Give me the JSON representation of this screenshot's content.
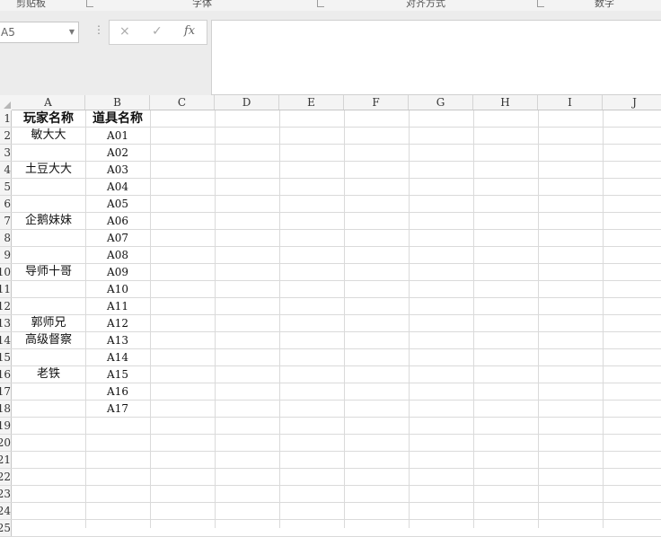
{
  "ribbon": {
    "groups": [
      {
        "label": "剪贴板"
      },
      {
        "label": "字体"
      },
      {
        "label": "对齐方式"
      },
      {
        "label": "数字"
      }
    ]
  },
  "formula_bar": {
    "name_box": "A5",
    "cancel_icon": "×",
    "enter_icon": "✓",
    "fx_label": "fx",
    "formula_value": ""
  },
  "sheet": {
    "columns": [
      "A",
      "B",
      "C",
      "D",
      "E",
      "F",
      "G",
      "H",
      "I",
      "J"
    ],
    "rows": [
      {
        "num": "1",
        "a": "玩家名称",
        "b": "道具名称"
      },
      {
        "num": "2",
        "a": "敏大大",
        "b": "A01"
      },
      {
        "num": "3",
        "a": "",
        "b": "A02"
      },
      {
        "num": "4",
        "a": "土豆大大",
        "b": "A03"
      },
      {
        "num": "5",
        "a": "",
        "b": "A04"
      },
      {
        "num": "6",
        "a": "",
        "b": "A05"
      },
      {
        "num": "7",
        "a": "企鹅妹妹",
        "b": "A06"
      },
      {
        "num": "8",
        "a": "",
        "b": "A07"
      },
      {
        "num": "9",
        "a": "",
        "b": "A08"
      },
      {
        "num": "10",
        "a": "导师十哥",
        "b": "A09"
      },
      {
        "num": "11",
        "a": "",
        "b": "A10"
      },
      {
        "num": "12",
        "a": "",
        "b": "A11"
      },
      {
        "num": "13",
        "a": "郭师兄",
        "b": "A12"
      },
      {
        "num": "14",
        "a": "高级督察",
        "b": "A13"
      },
      {
        "num": "15",
        "a": "",
        "b": "A14"
      },
      {
        "num": "16",
        "a": "老铁",
        "b": "A15"
      },
      {
        "num": "17",
        "a": "",
        "b": "A16"
      },
      {
        "num": "18",
        "a": "",
        "b": "A17"
      },
      {
        "num": "19",
        "a": "",
        "b": ""
      },
      {
        "num": "20",
        "a": "",
        "b": ""
      },
      {
        "num": "21",
        "a": "",
        "b": ""
      },
      {
        "num": "22",
        "a": "",
        "b": ""
      },
      {
        "num": "23",
        "a": "",
        "b": ""
      },
      {
        "num": "24",
        "a": "",
        "b": ""
      },
      {
        "num": "25",
        "a": "",
        "b": ""
      }
    ]
  }
}
